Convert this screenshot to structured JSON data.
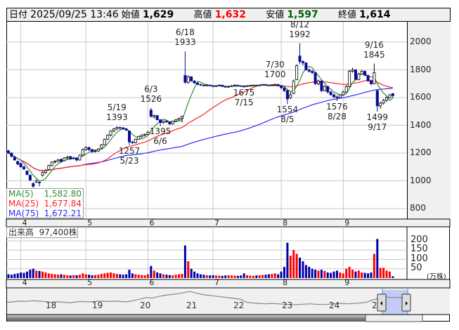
{
  "header": {
    "date_label": "日付",
    "datetime": "2025/09/25 13:46",
    "open_label": "始値",
    "open": "1,629",
    "high_label": "高値",
    "high": "1,632",
    "low_label": "安値",
    "low": "1,597",
    "close_label": "終値",
    "close": "1,614"
  },
  "colors": {
    "high": "#ff0000",
    "low": "#006400",
    "up_volume": "#ff0000",
    "down_volume": "#0000a8",
    "down_candle": "#0a0a96",
    "ma5": "#2e8b2e",
    "ma25": "#ff2020",
    "ma75": "#2a2aff"
  },
  "legend": {
    "ma5_label": "MA(5)",
    "ma5_value": "1,582.80",
    "ma25_label": "MA(25)",
    "ma25_value": "1,677.84",
    "ma75_label": "MA(75)",
    "ma75_value": "1,672.21"
  },
  "volume_panel": {
    "label": "出来高",
    "value": "97,400株",
    "unit": "(万株)",
    "ticks": [
      "200",
      "150",
      "100",
      "50"
    ]
  },
  "chart_data": {
    "type": "candlestick",
    "yaxis_ticks": [
      "2000",
      "1800",
      "1600",
      "1400",
      "1200",
      "1000",
      "800"
    ],
    "ylim": [
      760,
      2140
    ],
    "month_ticks": [
      {
        "label": "4",
        "index": 4
      },
      {
        "label": "5",
        "index": 25
      },
      {
        "label": "6",
        "index": 45
      },
      {
        "label": "7",
        "index": 66
      },
      {
        "label": "8",
        "index": 88
      },
      {
        "label": "9",
        "index": 108
      }
    ],
    "columns": [
      "date",
      "open",
      "high",
      "low",
      "close",
      "volume_10k"
    ],
    "rows": [
      [
        "03/26",
        1215,
        1225,
        1195,
        1200,
        20
      ],
      [
        "03/27",
        1200,
        1205,
        1170,
        1175,
        18
      ],
      [
        "03/28",
        1170,
        1178,
        1145,
        1150,
        22
      ],
      [
        "03/31",
        1140,
        1145,
        1112,
        1120,
        25
      ],
      [
        "04/01",
        1125,
        1130,
        1095,
        1100,
        30
      ],
      [
        "04/02",
        1100,
        1110,
        1080,
        1085,
        28
      ],
      [
        "04/03",
        1070,
        1075,
        1040,
        1045,
        35
      ],
      [
        "04/04",
        1040,
        1045,
        1000,
        1005,
        45
      ],
      [
        "04/07",
        980,
        990,
        950,
        960,
        50
      ],
      [
        "04/08",
        990,
        1010,
        985,
        1000,
        40
      ],
      [
        "04/09",
        990,
        995,
        960,
        985,
        38
      ],
      [
        "04/10",
        1040,
        1070,
        1030,
        1060,
        35
      ],
      [
        "04/11",
        1060,
        1085,
        1050,
        1075,
        30
      ],
      [
        "04/14",
        1080,
        1115,
        1075,
        1110,
        25
      ],
      [
        "04/15",
        1110,
        1140,
        1105,
        1135,
        22
      ],
      [
        "04/16",
        1135,
        1150,
        1125,
        1140,
        20
      ],
      [
        "04/17",
        1140,
        1158,
        1135,
        1150,
        18
      ],
      [
        "04/18",
        1155,
        1160,
        1130,
        1140,
        20
      ],
      [
        "04/21",
        1145,
        1170,
        1140,
        1165,
        18
      ],
      [
        "04/22",
        1165,
        1180,
        1155,
        1170,
        15
      ],
      [
        "04/23",
        1175,
        1178,
        1150,
        1160,
        14
      ],
      [
        "04/24",
        1160,
        1172,
        1155,
        1165,
        16
      ],
      [
        "04/25",
        1165,
        1168,
        1140,
        1150,
        15
      ],
      [
        "04/28",
        1150,
        1190,
        1145,
        1185,
        18
      ],
      [
        "04/30",
        1185,
        1235,
        1180,
        1225,
        25
      ],
      [
        "05/01",
        1225,
        1250,
        1215,
        1240,
        20
      ],
      [
        "05/02",
        1240,
        1245,
        1215,
        1225,
        18
      ],
      [
        "05/07",
        1225,
        1230,
        1200,
        1210,
        15
      ],
      [
        "05/08",
        1210,
        1222,
        1205,
        1215,
        16
      ],
      [
        "05/09",
        1215,
        1235,
        1210,
        1230,
        18
      ],
      [
        "05/12",
        1235,
        1265,
        1230,
        1260,
        22
      ],
      [
        "05/13",
        1260,
        1305,
        1255,
        1300,
        25
      ],
      [
        "05/14",
        1300,
        1335,
        1295,
        1330,
        28
      ],
      [
        "05/15",
        1330,
        1365,
        1320,
        1360,
        30
      ],
      [
        "05/16",
        1360,
        1380,
        1350,
        1375,
        26
      ],
      [
        "05/19",
        1375,
        1393,
        1365,
        1385,
        22
      ],
      [
        "05/20",
        1385,
        1390,
        1370,
        1380,
        20
      ],
      [
        "05/21",
        1382,
        1388,
        1368,
        1375,
        18
      ],
      [
        "05/22",
        1375,
        1380,
        1360,
        1365,
        20
      ],
      [
        "05/23",
        1360,
        1362,
        1257,
        1280,
        45
      ],
      [
        "05/26",
        1280,
        1290,
        1265,
        1275,
        25
      ],
      [
        "05/27",
        1275,
        1305,
        1270,
        1300,
        20
      ],
      [
        "05/28",
        1300,
        1325,
        1295,
        1320,
        18
      ],
      [
        "05/29",
        1318,
        1335,
        1310,
        1330,
        16
      ],
      [
        "05/30",
        1330,
        1340,
        1320,
        1335,
        15
      ],
      [
        "06/02",
        1335,
        1360,
        1330,
        1350,
        20
      ],
      [
        "06/03",
        1510,
        1526,
        1455,
        1465,
        65
      ],
      [
        "06/04",
        1460,
        1480,
        1450,
        1470,
        40
      ],
      [
        "06/05",
        1470,
        1475,
        1435,
        1440,
        30
      ],
      [
        "06/06",
        1440,
        1445,
        1395,
        1420,
        25
      ],
      [
        "06/09",
        1420,
        1435,
        1410,
        1430,
        20
      ],
      [
        "06/10",
        1430,
        1438,
        1418,
        1425,
        18
      ],
      [
        "06/11",
        1425,
        1430,
        1405,
        1410,
        16
      ],
      [
        "06/12",
        1410,
        1435,
        1405,
        1430,
        15
      ],
      [
        "06/13",
        1430,
        1445,
        1425,
        1440,
        18
      ],
      [
        "06/16",
        1440,
        1455,
        1435,
        1450,
        20
      ],
      [
        "06/17",
        1450,
        1470,
        1420,
        1465,
        22
      ],
      [
        "06/18",
        1760,
        1933,
        1700,
        1710,
        175
      ],
      [
        "06/19",
        1710,
        1760,
        1700,
        1750,
        90
      ],
      [
        "06/20",
        1750,
        1755,
        1715,
        1720,
        50
      ],
      [
        "06/23",
        1720,
        1725,
        1700,
        1705,
        35
      ],
      [
        "06/24",
        1705,
        1710,
        1690,
        1695,
        25
      ],
      [
        "06/25",
        1695,
        1700,
        1685,
        1690,
        20
      ],
      [
        "06/26",
        1690,
        1695,
        1680,
        1685,
        18
      ],
      [
        "06/27",
        1685,
        1695,
        1682,
        1690,
        15
      ],
      [
        "06/30",
        1690,
        1692,
        1680,
        1685,
        14
      ],
      [
        "07/01",
        1685,
        1688,
        1676,
        1680,
        15
      ],
      [
        "07/02",
        1680,
        1690,
        1678,
        1685,
        14
      ],
      [
        "07/03",
        1685,
        1695,
        1682,
        1690,
        13
      ],
      [
        "07/04",
        1690,
        1692,
        1678,
        1680,
        12
      ],
      [
        "07/07",
        1680,
        1683,
        1672,
        1675,
        14
      ],
      [
        "07/08",
        1675,
        1685,
        1673,
        1680,
        15
      ],
      [
        "07/09",
        1680,
        1690,
        1678,
        1685,
        14
      ],
      [
        "07/10",
        1685,
        1695,
        1683,
        1690,
        13
      ],
      [
        "07/11",
        1690,
        1692,
        1680,
        1685,
        12
      ],
      [
        "07/14",
        1685,
        1688,
        1678,
        1680,
        14
      ],
      [
        "07/15",
        1682,
        1686,
        1675,
        1680,
        25
      ],
      [
        "07/16",
        1680,
        1690,
        1678,
        1685,
        15
      ],
      [
        "07/17",
        1685,
        1692,
        1683,
        1688,
        13
      ],
      [
        "07/18",
        1688,
        1694,
        1685,
        1690,
        12
      ],
      [
        "07/22",
        1690,
        1692,
        1682,
        1685,
        14
      ],
      [
        "07/23",
        1685,
        1694,
        1683,
        1690,
        15
      ],
      [
        "07/24",
        1690,
        1698,
        1688,
        1695,
        16
      ],
      [
        "07/25",
        1695,
        1697,
        1686,
        1690,
        18
      ],
      [
        "07/28",
        1690,
        1693,
        1684,
        1688,
        20
      ],
      [
        "07/29",
        1688,
        1696,
        1686,
        1692,
        22
      ],
      [
        "07/30",
        1692,
        1700,
        1690,
        1695,
        25
      ],
      [
        "07/31",
        1695,
        1697,
        1680,
        1685,
        20
      ],
      [
        "08/01",
        1685,
        1690,
        1665,
        1670,
        35
      ],
      [
        "08/04",
        1670,
        1675,
        1640,
        1650,
        60
      ],
      [
        "08/05",
        1650,
        1660,
        1554,
        1590,
        190
      ],
      [
        "08/06",
        1600,
        1640,
        1590,
        1620,
        120
      ],
      [
        "08/07",
        1630,
        1730,
        1625,
        1720,
        150
      ],
      [
        "08/08",
        1730,
        1840,
        1725,
        1830,
        130
      ],
      [
        "08/12",
        1900,
        1992,
        1840,
        1860,
        110
      ],
      [
        "08/13",
        1860,
        1870,
        1830,
        1850,
        90
      ],
      [
        "08/14",
        1850,
        1855,
        1795,
        1800,
        70
      ],
      [
        "08/15",
        1800,
        1810,
        1780,
        1790,
        60
      ],
      [
        "08/18",
        1790,
        1800,
        1770,
        1780,
        50
      ],
      [
        "08/19",
        1780,
        1785,
        1690,
        1700,
        45
      ],
      [
        "08/20",
        1700,
        1730,
        1690,
        1720,
        40
      ],
      [
        "08/21",
        1720,
        1725,
        1640,
        1650,
        45
      ],
      [
        "08/22",
        1650,
        1690,
        1645,
        1680,
        38
      ],
      [
        "08/25",
        1680,
        1685,
        1630,
        1640,
        30
      ],
      [
        "08/26",
        1640,
        1650,
        1615,
        1620,
        28
      ],
      [
        "08/27",
        1620,
        1630,
        1600,
        1605,
        35
      ],
      [
        "08/28",
        1605,
        1615,
        1576,
        1600,
        40
      ],
      [
        "08/29",
        1600,
        1625,
        1595,
        1620,
        30
      ],
      [
        "09/01",
        1620,
        1650,
        1615,
        1640,
        25
      ],
      [
        "09/02",
        1640,
        1690,
        1635,
        1680,
        50
      ],
      [
        "09/03",
        1680,
        1800,
        1675,
        1790,
        60
      ],
      [
        "09/04",
        1790,
        1815,
        1780,
        1800,
        45
      ],
      [
        "09/05",
        1800,
        1805,
        1725,
        1730,
        35
      ],
      [
        "09/08",
        1730,
        1780,
        1725,
        1770,
        40
      ],
      [
        "09/09",
        1770,
        1800,
        1765,
        1790,
        30
      ],
      [
        "09/10",
        1790,
        1795,
        1755,
        1760,
        28
      ],
      [
        "09/11",
        1760,
        1765,
        1715,
        1720,
        25
      ],
      [
        "09/12",
        1720,
        1725,
        1690,
        1700,
        30
      ],
      [
        "09/16",
        1700,
        1845,
        1695,
        1780,
        130
      ],
      [
        "09/17",
        1650,
        1655,
        1499,
        1540,
        210
      ],
      [
        "09/18",
        1540,
        1570,
        1520,
        1560,
        55
      ],
      [
        "09/19",
        1560,
        1590,
        1550,
        1580,
        55
      ],
      [
        "09/22",
        1580,
        1610,
        1570,
        1600,
        40
      ],
      [
        "09/24",
        1600,
        1625,
        1595,
        1620,
        35
      ],
      [
        "09/25",
        1629,
        1632,
        1597,
        1614,
        9.74
      ]
    ],
    "annotations": [
      {
        "date": "5/19",
        "price": "1393",
        "at": "high",
        "index": 35
      },
      {
        "date": "5/23",
        "price": "1257",
        "at": "low",
        "index": 39
      },
      {
        "date": "6/3",
        "price": "1526",
        "at": "high",
        "index": 46
      },
      {
        "date": "6/6",
        "price": "1395",
        "at": "low",
        "index": 49
      },
      {
        "date": "6/18",
        "price": "1933",
        "at": "high",
        "index": 57
      },
      {
        "date": "7/15",
        "price": "1675",
        "at": "low",
        "index": 76
      },
      {
        "date": "7/30",
        "price": "1700",
        "at": "high",
        "index": 86
      },
      {
        "date": "8/5",
        "price": "1554",
        "at": "low",
        "index": 90
      },
      {
        "date": "8/12",
        "price": "1992",
        "at": "high",
        "index": 94
      },
      {
        "date": "8/28",
        "price": "1576",
        "at": "low",
        "index": 106
      },
      {
        "date": "9/16",
        "price": "1845",
        "at": "high",
        "index": 118
      },
      {
        "date": "9/17",
        "price": "1499",
        "at": "low",
        "index": 119
      }
    ]
  },
  "navigator": {
    "year_labels": [
      "18",
      "19",
      "20",
      "21",
      "22",
      "23",
      "24",
      "2"
    ],
    "series": [
      30,
      31,
      33,
      32,
      34,
      33,
      32,
      30,
      31,
      30,
      29,
      31,
      32,
      31,
      32,
      33,
      32,
      33,
      32,
      31,
      34,
      38,
      42,
      41,
      45,
      48,
      50,
      52,
      55,
      58,
      54,
      50,
      48,
      46,
      44,
      42,
      40,
      38,
      30,
      28,
      27,
      26,
      27,
      26,
      25,
      24,
      24,
      25,
      26,
      25,
      24,
      25,
      26,
      27,
      26,
      27,
      28,
      30,
      36,
      40,
      44,
      42,
      43,
      41
    ]
  }
}
